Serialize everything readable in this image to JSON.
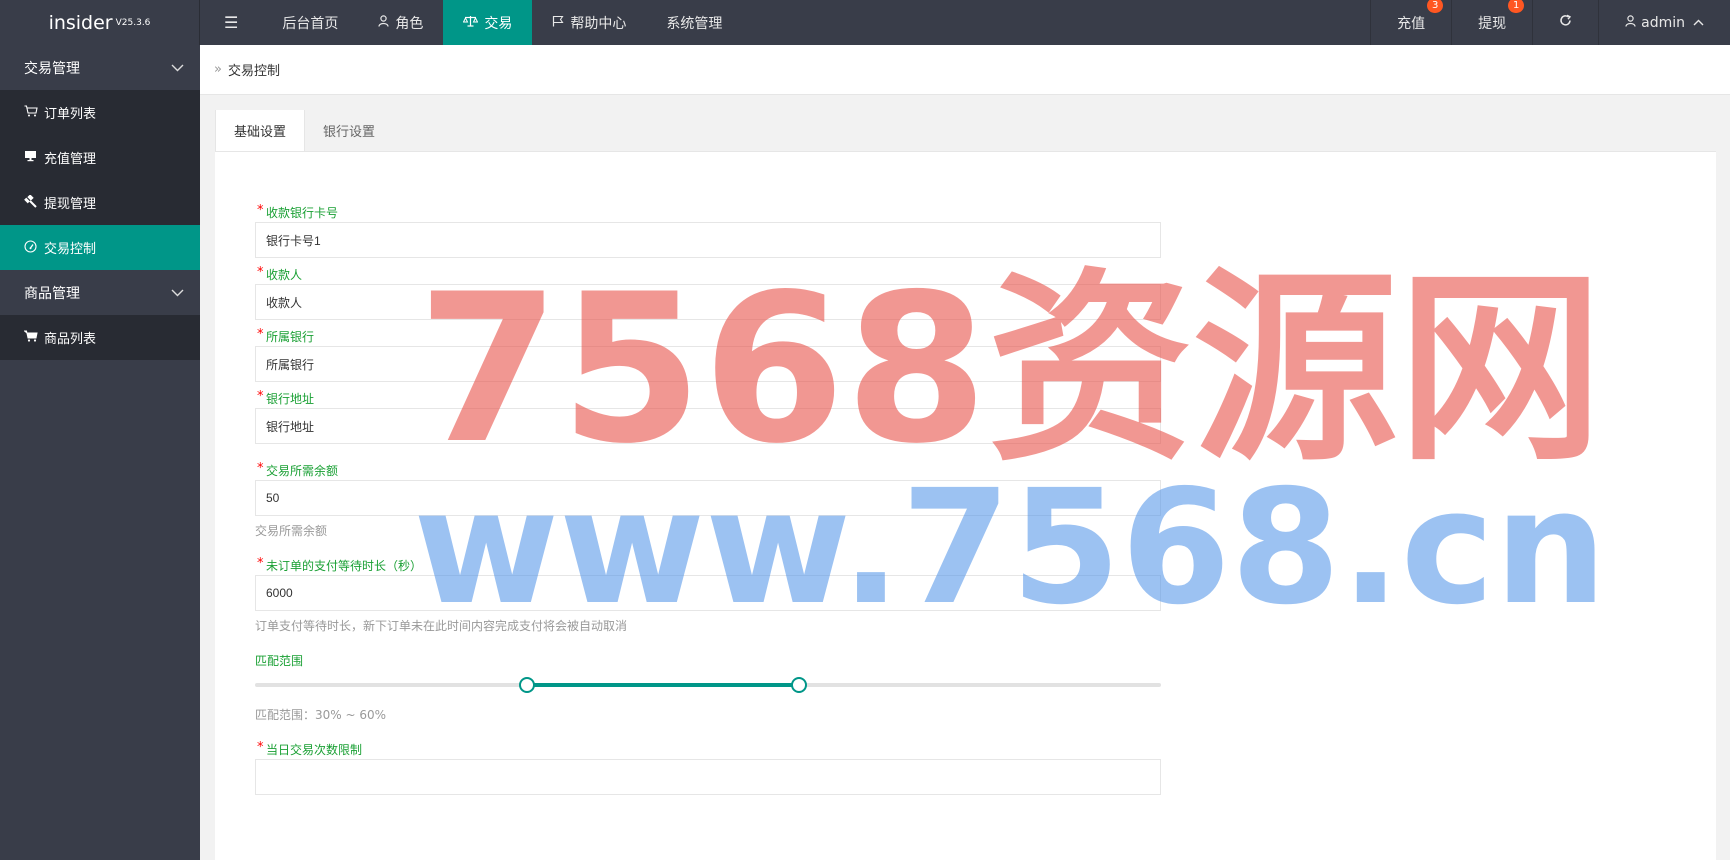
{
  "app": {
    "name": "insider",
    "version": "V25.3.6"
  },
  "topnav": {
    "menu_icon": "menu-toggle-icon",
    "items": [
      {
        "label": "后台首页",
        "icon": ""
      },
      {
        "label": "角色",
        "icon": "user-icon"
      },
      {
        "label": "交易",
        "icon": "balance-scale-icon"
      },
      {
        "label": "帮助中心",
        "icon": "flag-icon"
      },
      {
        "label": "系统管理",
        "icon": ""
      }
    ],
    "active": "交易"
  },
  "topright": {
    "recharge": {
      "label": "充值",
      "badge": "3"
    },
    "withdraw": {
      "label": "提现",
      "badge": "1"
    },
    "refresh_icon": "refresh-icon",
    "user": {
      "label": "admin"
    }
  },
  "sidebar": {
    "group1": {
      "label": "交易管理"
    },
    "items1": [
      {
        "label": "订单列表",
        "icon": "cart-icon"
      },
      {
        "label": "充值管理",
        "icon": "monitor-icon"
      },
      {
        "label": "提现管理",
        "icon": "gavel-icon"
      },
      {
        "label": "交易控制",
        "icon": "dashboard-icon"
      }
    ],
    "group2": {
      "label": "商品管理"
    },
    "items2": [
      {
        "label": "商品列表",
        "icon": "cart-solid-icon"
      }
    ]
  },
  "breadcrumb": {
    "current": "交易控制"
  },
  "tabs": [
    {
      "label": "基础设置"
    },
    {
      "label": "银行设置"
    }
  ],
  "form": {
    "bank_card": {
      "label": "收款银行卡号",
      "value": "银行卡号1"
    },
    "payee": {
      "label": "收款人",
      "value": "收款人"
    },
    "bank": {
      "label": "所属银行",
      "value": "所属银行"
    },
    "bank_address": {
      "label": "银行地址",
      "value": "银行地址"
    },
    "min_balance": {
      "label": "交易所需余额",
      "value": "50",
      "hint": "交易所需余额"
    },
    "pay_wait": {
      "label": "未订单的支付等待时长（秒）",
      "value": "6000",
      "hint": "订单支付等待时长，新下订单未在此时间内容完成支付将会被自动取消"
    },
    "match_range": {
      "label": "匹配范围",
      "min": 30,
      "max": 60,
      "hint": "匹配范围：30% ~ 60%"
    },
    "daily_limit": {
      "label": "当日交易次数限制"
    }
  },
  "watermark": {
    "line1": "7568资源网",
    "line2": "www.7568.cn",
    "color1": "#e8524a",
    "color2": "#4a90e8"
  }
}
